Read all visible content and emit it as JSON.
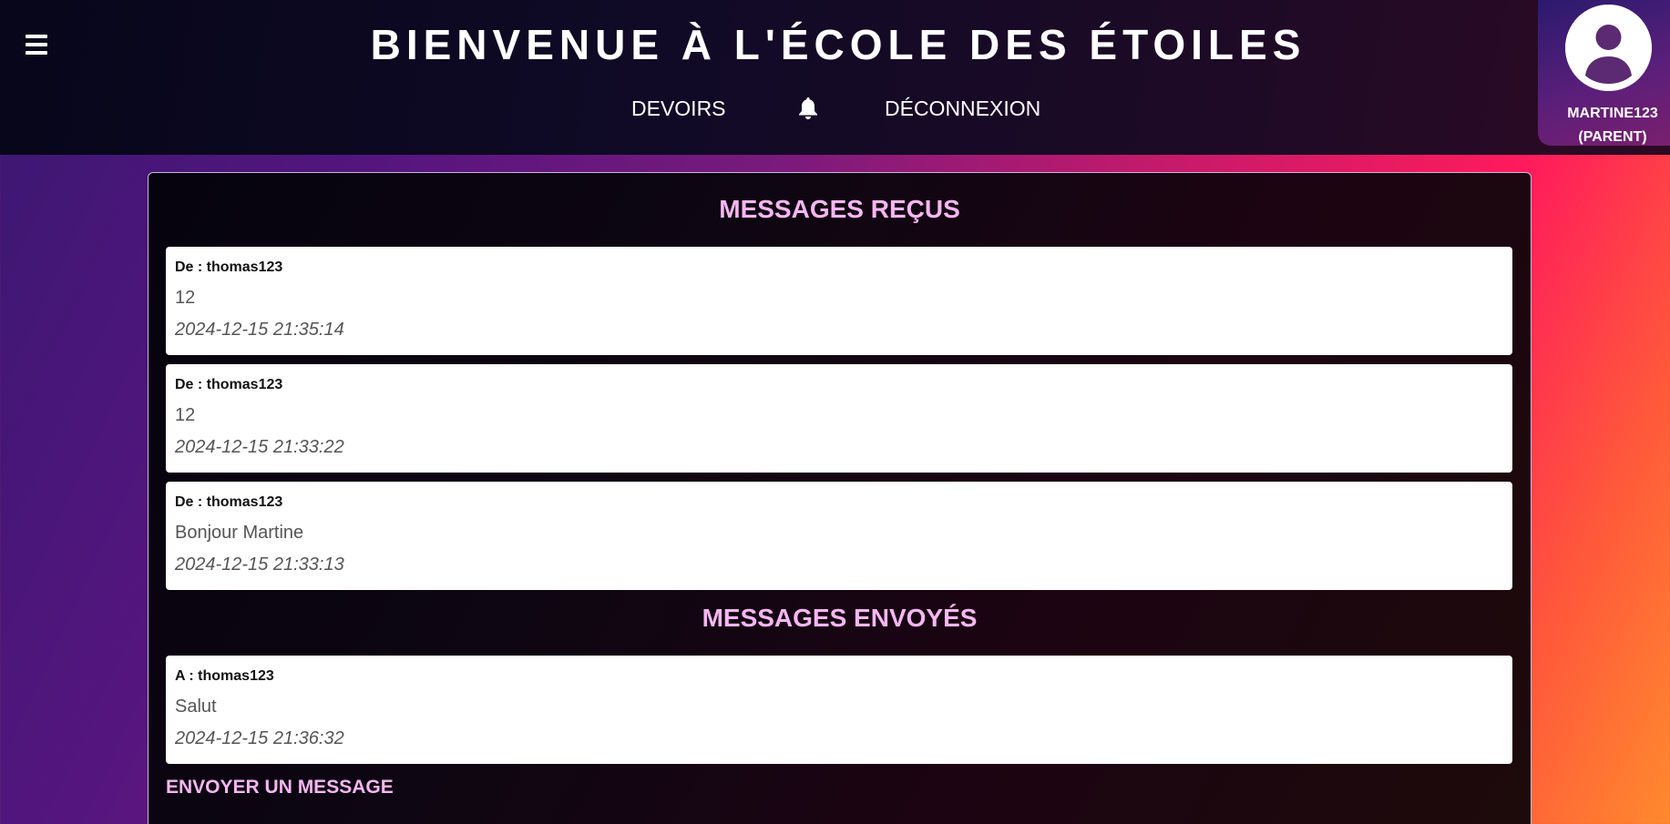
{
  "header": {
    "title": "BIENVENUE À L'ÉCOLE DES ÉTOILES",
    "nav": {
      "devoirs": "DEVOIRS",
      "bell_icon": "bell-icon",
      "logout": "DÉCONNEXION"
    },
    "menu_icon": "hamburger-menu-icon"
  },
  "profile": {
    "avatar_icon": "user-avatar-icon",
    "name": "MARTINE123",
    "role": "(PARENT)"
  },
  "received": {
    "title": "MESSAGES REÇUS",
    "messages": [
      {
        "from": "De : thomas123",
        "body": "12",
        "date": "2024-12-15 21:35:14"
      },
      {
        "from": "De : thomas123",
        "body": "12",
        "date": "2024-12-15 21:33:22"
      },
      {
        "from": "De : thomas123",
        "body": "Bonjour Martine",
        "date": "2024-12-15 21:33:13"
      }
    ]
  },
  "sent": {
    "title": "MESSAGES ENVOYÉS",
    "messages": [
      {
        "to": "A : thomas123",
        "body": "Salut",
        "date": "2024-12-15 21:36:32"
      }
    ]
  },
  "compose": {
    "title": "ENVOYER UN MESSAGE"
  },
  "colors": {
    "accent_pink": "#f7b6f2",
    "header_bg": "#0b0820",
    "card_bg": "#ffffff"
  }
}
